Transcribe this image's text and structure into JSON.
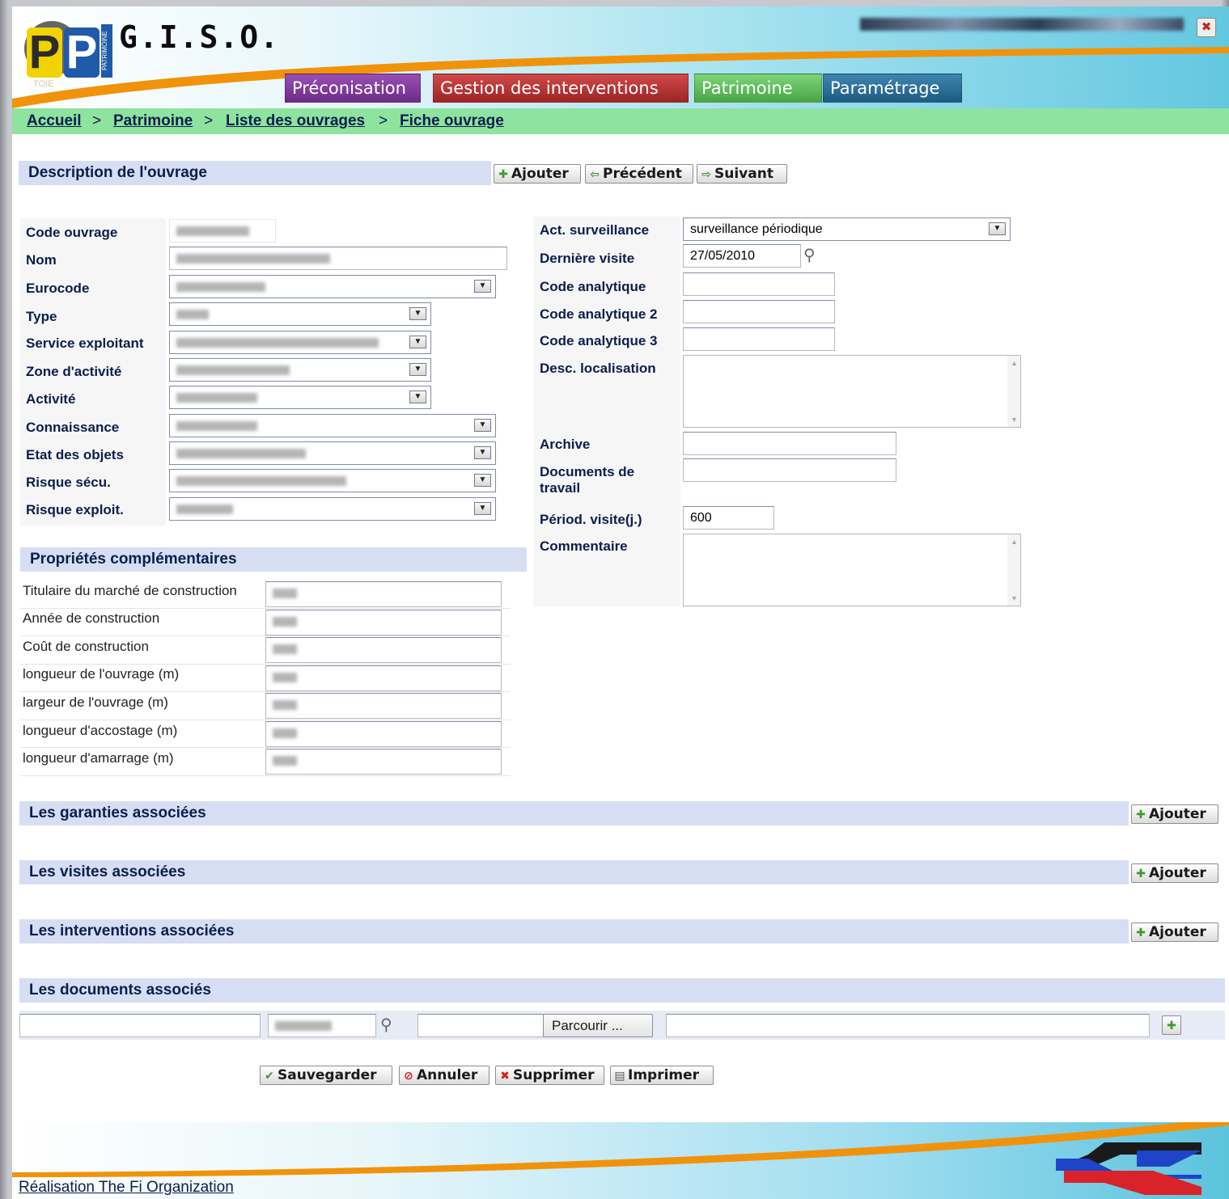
{
  "header": {
    "logo_text": [
      "P",
      "P"
    ],
    "logo_strip": "PATRIMOINE",
    "logo_tag": "TOIE",
    "title": "G.I.S.O.",
    "close_icon": "close-icon"
  },
  "menu": {
    "tabs": [
      {
        "label": "Préconisation",
        "color": "#6b2c86"
      },
      {
        "label": "Gestion des interventions",
        "color": "#9e2424"
      },
      {
        "label": "Patrimoine",
        "color": "#47a544"
      },
      {
        "label": "Paramétrage",
        "color": "#1d5b82"
      }
    ]
  },
  "breadcrumb": {
    "items": [
      "Accueil",
      "Patrimoine",
      "Liste des ouvrages",
      "Fiche ouvrage"
    ],
    "separator": ">"
  },
  "description": {
    "title": "Description de l'ouvrage",
    "buttons": {
      "add": "Ajouter",
      "prev": "Précédent",
      "next": "Suivant"
    },
    "left_fields": [
      {
        "label": "Code ouvrage"
      },
      {
        "label": "Nom"
      },
      {
        "label": "Eurocode"
      },
      {
        "label": "Type"
      },
      {
        "label": "Service exploitant"
      },
      {
        "label": "Zone d'activité"
      },
      {
        "label": "Activité"
      },
      {
        "label": "Connaissance"
      },
      {
        "label": "Etat des objets"
      },
      {
        "label": "Risque sécu."
      },
      {
        "label": "Risque exploit."
      }
    ],
    "right_fields": {
      "act_surveillance": {
        "label": "Act. surveillance",
        "value": "surveillance périodique"
      },
      "derniere_visite": {
        "label": "Dernière visite",
        "value": "27/05/2010"
      },
      "code_analytique": {
        "label": "Code analytique",
        "value": ""
      },
      "code_analytique_2": {
        "label": "Code analytique 2",
        "value": ""
      },
      "code_analytique_3": {
        "label": "Code analytique 3",
        "value": ""
      },
      "desc_localisation": {
        "label": "Desc. localisation",
        "value": ""
      },
      "archive": {
        "label": "Archive",
        "value": ""
      },
      "documents_travail": {
        "label": "Documents de travail",
        "value": ""
      },
      "periode_visite": {
        "label": "Périod. visite(j.)",
        "value": "600"
      },
      "commentaire": {
        "label": "Commentaire",
        "value": ""
      }
    }
  },
  "properties": {
    "title": "Propriétés complémentaires",
    "rows": [
      {
        "label": "Titulaire du marché de construction"
      },
      {
        "label": "Année de construction"
      },
      {
        "label": "Coût de construction"
      },
      {
        "label": "longueur de l'ouvrage (m)"
      },
      {
        "label": "largeur de l'ouvrage (m)"
      },
      {
        "label": "longueur d'accostage (m)"
      },
      {
        "label": "longueur d'amarrage (m)"
      }
    ]
  },
  "sections": [
    {
      "title": "Les garanties associées",
      "button": "Ajouter"
    },
    {
      "title": "Les visites associées",
      "button": "Ajouter"
    },
    {
      "title": "Les interventions associées",
      "button": "Ajouter"
    }
  ],
  "documents": {
    "title": "Les documents associés",
    "browse_label": "Parcourir ..."
  },
  "actions": {
    "save": "Sauvegarder",
    "cancel": "Annuler",
    "delete": "Supprimer",
    "print": "Imprimer"
  },
  "footer": {
    "credit": "Réalisation The Fi Organization"
  }
}
